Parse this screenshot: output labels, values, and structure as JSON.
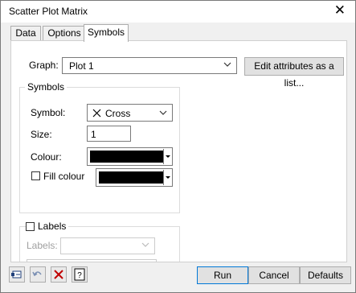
{
  "window": {
    "title": "Scatter Plot Matrix",
    "close_glyph": "✕"
  },
  "tabs": [
    {
      "label": "Data"
    },
    {
      "label": "Options"
    },
    {
      "label": "Symbols"
    }
  ],
  "graph": {
    "label": "Graph:",
    "value": "Plot 1",
    "edit_button": "Edit attributes as a list..."
  },
  "symbols_group": {
    "title": "Symbols",
    "symbol_label": "Symbol:",
    "symbol_value": "Cross",
    "size_label": "Size:",
    "size_value": "1",
    "colour_label": "Colour:",
    "colour_value": "#000000",
    "fill_colour_label": "Fill colour",
    "fill_colour_checked": false,
    "fill_colour_value": "#000000"
  },
  "labels_group": {
    "title": "Labels",
    "checked": false,
    "labels_label": "Labels:",
    "labels_value": ""
  },
  "footer": {
    "run": "Run",
    "cancel": "Cancel",
    "defaults": "Defaults",
    "icons": [
      "pin-icon",
      "undo-icon",
      "clear-icon",
      "help-icon"
    ]
  }
}
